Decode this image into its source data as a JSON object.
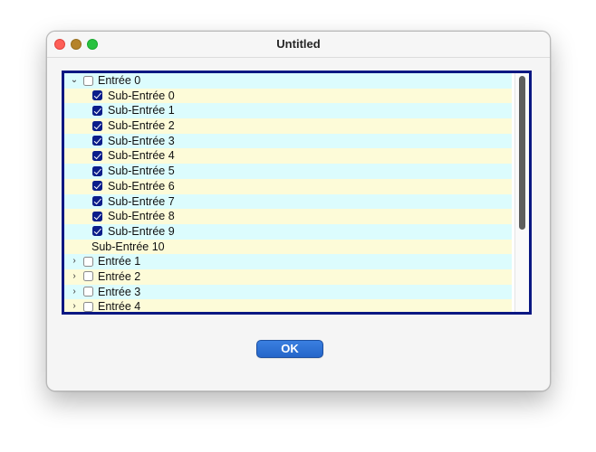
{
  "window": {
    "title": "Untitled"
  },
  "tree": {
    "root_expanded": {
      "label": "Entrée 0",
      "expanded": true,
      "checked": false,
      "children": [
        {
          "label": "Sub-Entrée 0",
          "checked": true
        },
        {
          "label": "Sub-Entrée 1",
          "checked": true
        },
        {
          "label": "Sub-Entrée 2",
          "checked": true
        },
        {
          "label": "Sub-Entrée 3",
          "checked": true
        },
        {
          "label": "Sub-Entrée 4",
          "checked": true
        },
        {
          "label": "Sub-Entrée 5",
          "checked": true
        },
        {
          "label": "Sub-Entrée 6",
          "checked": true
        },
        {
          "label": "Sub-Entrée 7",
          "checked": true
        },
        {
          "label": "Sub-Entrée 8",
          "checked": true
        },
        {
          "label": "Sub-Entrée 9",
          "checked": true
        },
        {
          "label": "Sub-Entrée 10",
          "checkbox": false
        }
      ]
    },
    "collapsed_entries": [
      {
        "label": "Entrée 1",
        "checked": false
      },
      {
        "label": "Entrée 2",
        "checked": false
      },
      {
        "label": "Entrée 3",
        "checked": false
      },
      {
        "label": "Entrée 4",
        "checked": false
      }
    ],
    "icons": {
      "expanded": "chevron-down-icon",
      "collapsed": "chevron-right-icon"
    },
    "colors": {
      "border": "#0a1782",
      "row_even": "#dcfcfd",
      "row_odd": "#fdfbd8",
      "checkbox_checked": "#0b1d8a"
    }
  },
  "buttons": {
    "ok_label": "OK"
  }
}
